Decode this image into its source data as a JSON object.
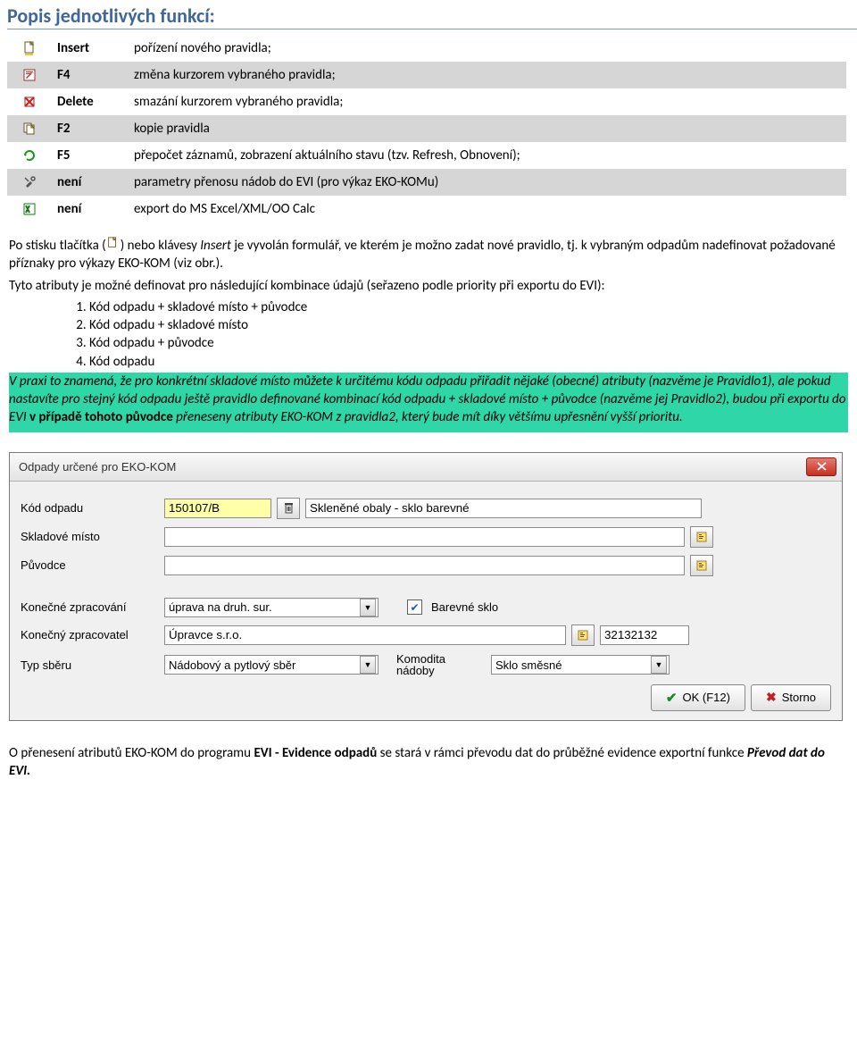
{
  "heading": "Popis jednotlivých funkcí:",
  "funcs": [
    {
      "key": "Insert",
      "desc": "pořízení nového pravidla;"
    },
    {
      "key": "F4",
      "desc": "změna kurzorem vybraného pravidla;"
    },
    {
      "key": "Delete",
      "desc": "smazání kurzorem vybraného pravidla;"
    },
    {
      "key": "F2",
      "desc": "kopie pravidla"
    },
    {
      "key": "F5",
      "desc": "přepočet záznamů, zobrazení aktuálního stavu (tzv. Refresh, Obnovení);"
    },
    {
      "key": "není",
      "desc": "parametry přenosu nádob do EVI (pro výkaz EKO-KOMu)"
    },
    {
      "key": "není",
      "desc": "export do MS Excel/XML/OO Calc"
    }
  ],
  "para1_a": "Po stisku tlačítka (",
  "para1_b": ") nebo klávesy ",
  "para1_insert": "Insert",
  "para1_c": " je vyvolán formulář, ve kterém je možno zadat nové pravidlo, tj. k vybraným odpadům nadefinovat požadované příznaky pro výkazy EKO-KOM (viz obr.).",
  "para2": "Tyto atributy je možné definovat pro následující kombinace údajů (seřazeno podle priority při exportu do EVI):",
  "list": [
    "Kód odpadu + skladové místo + původce",
    "Kód odpadu + skladové místo",
    "Kód odpadu + původce",
    "Kód odpadu"
  ],
  "hl_a": "V praxi to znamená, že pro konkrétní skladové místo můžete k určitému kódu odpadu přiřadit nějaké (obecné) atributy (nazvěme je Pravidlo1), ale pokud nastavíte pro stejný kód odpadu ještě pravidlo definované kombinací kód odpadu + skladové místo + původce (nazvěme jej Pravidlo2), budou při exportu do EVI ",
  "hl_b": "v případě tohoto původce",
  "hl_c": " přeneseny atributy EKO-KOM z pravidla2, který bude mít díky většímu upřesnění vyšší prioritu.",
  "dialog": {
    "title": "Odpady určené pro EKO-KOM",
    "labels": {
      "kod": "Kód odpadu",
      "sklad": "Skladové místo",
      "puvodce": "Původce",
      "kzprac": "Konečné zpracování",
      "kzpracovatel": "Konečný zpracovatel",
      "typ": "Typ sběru",
      "komodita": "Komodita\nnádoby"
    },
    "values": {
      "kod": "150107/B",
      "kod_name": "Skleněné obaly - sklo barevné",
      "sklad": "",
      "puvodce": "",
      "kzprac": "úprava na druh. sur.",
      "barevne_chk": "Barevné sklo",
      "kzpracovatel": "Úpravce s.r.o.",
      "kzpracovatel_id": "32132132",
      "typ": "Nádobový a pytlový sběr",
      "komodita": "Sklo směsné"
    },
    "buttons": {
      "ok": "OK (F12)",
      "storno": "Storno"
    }
  },
  "footer_a": "O přenesení atributů EKO-KOM do programu ",
  "footer_b": "EVI - Evidence odpadů",
  "footer_c": " se stará v rámci převodu dat do průběžné evidence exportní funkce ",
  "footer_d": "Převod dat do EVI."
}
